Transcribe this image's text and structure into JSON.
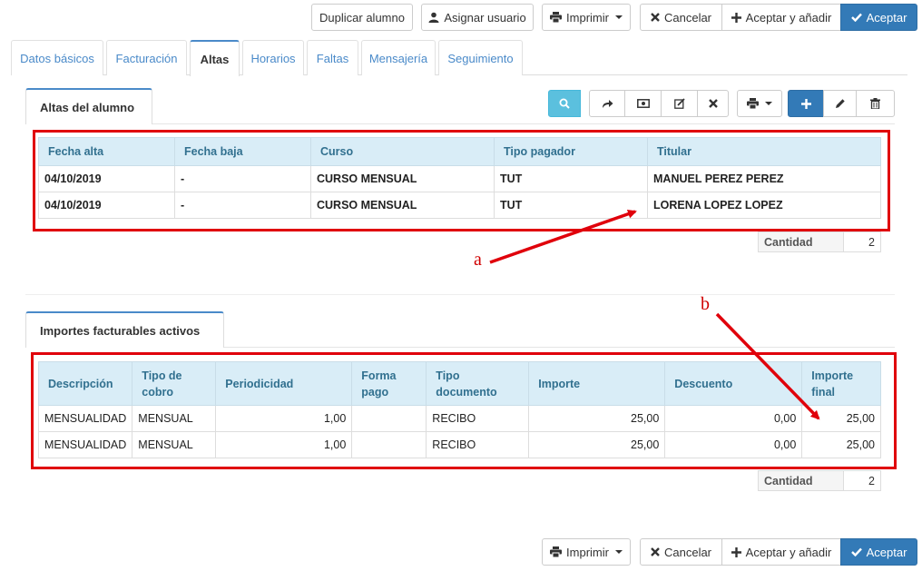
{
  "top_toolbar": {
    "duplicate_label": "Duplicar alumno",
    "assign_user_label": "Asignar usuario",
    "print_label": "Imprimir",
    "cancel_label": "Cancelar",
    "accept_add_label": "Aceptar y añadir",
    "accept_label": "Aceptar"
  },
  "tabs": [
    {
      "label": "Datos básicos"
    },
    {
      "label": "Facturación"
    },
    {
      "label": "Altas"
    },
    {
      "label": "Horarios"
    },
    {
      "label": "Faltas"
    },
    {
      "label": "Mensajería"
    },
    {
      "label": "Seguimiento"
    }
  ],
  "altas": {
    "tab_label": "Altas del alumno",
    "headers": [
      "Fecha alta",
      "Fecha baja",
      "Curso",
      "Tipo pagador",
      "Titular"
    ],
    "rows": [
      [
        "04/10/2019",
        "-",
        "CURSO MENSUAL",
        "TUT",
        "MANUEL PEREZ PEREZ"
      ],
      [
        "04/10/2019",
        "-",
        "CURSO MENSUAL",
        "TUT",
        "LORENA LOPEZ LOPEZ"
      ]
    ],
    "count_label": "Cantidad",
    "count_value": "2"
  },
  "importes": {
    "tab_label": "Importes facturables activos",
    "headers": [
      "Descripción",
      "Tipo de cobro",
      "Periodicidad",
      "Forma pago",
      "Tipo documento",
      "Importe",
      "Descuento",
      "Importe final"
    ],
    "rows": [
      [
        "MENSUALIDAD",
        "MENSUAL",
        "1,00",
        "",
        "RECIBO",
        "25,00",
        "0,00",
        "25,00"
      ],
      [
        "MENSUALIDAD",
        "MENSUAL",
        "1,00",
        "",
        "RECIBO",
        "25,00",
        "0,00",
        "25,00"
      ]
    ],
    "count_label": "Cantidad",
    "count_value": "2"
  },
  "bottom_toolbar": {
    "print_label": "Imprimir",
    "cancel_label": "Cancelar",
    "accept_add_label": "Aceptar y añadir",
    "accept_label": "Aceptar"
  },
  "annotations": {
    "a": "a",
    "b": "b"
  },
  "colors": {
    "primary": "#337ab7",
    "info": "#5bc0de",
    "header_bg": "#d9edf7",
    "highlight_red": "#e0000b"
  }
}
